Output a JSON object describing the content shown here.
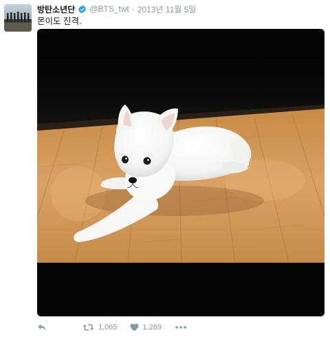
{
  "tweet": {
    "display_name": "방탄소년단",
    "verified": true,
    "handle": "@BTS_twt",
    "separator": "·",
    "timestamp": "2013년 11월 5일",
    "text": "몬이도 진격."
  },
  "actions": {
    "retweet_count": "1,065",
    "like_count": "1,289"
  },
  "colors": {
    "verified": "#1da1f2",
    "meta_text": "#8899a6",
    "media_background": "#050505"
  },
  "icons": [
    "reply-icon",
    "retweet-icon",
    "like-icon",
    "more-icon",
    "verified-badge-icon"
  ]
}
